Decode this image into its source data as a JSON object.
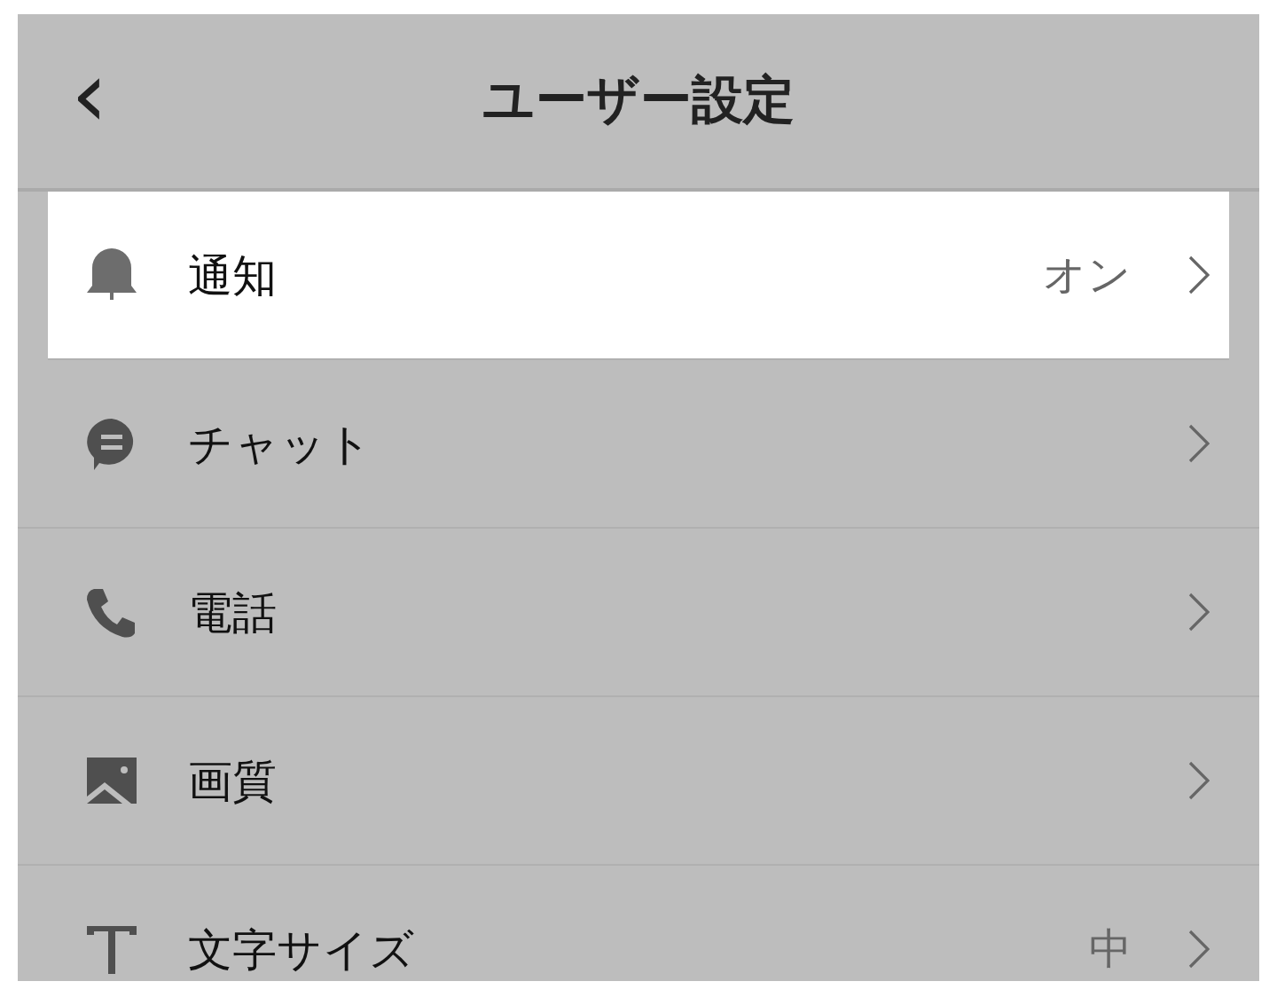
{
  "header": {
    "back": "‹",
    "title": "ユーザー設定"
  },
  "items": [
    {
      "label": "通知",
      "value": "オン",
      "selected": true
    },
    {
      "label": "チャット",
      "selected": false
    },
    {
      "label": "電話",
      "selected": false
    },
    {
      "label": "画質",
      "selected": false
    },
    {
      "label": "文字サイズ",
      "value": "中",
      "selected": false
    }
  ]
}
